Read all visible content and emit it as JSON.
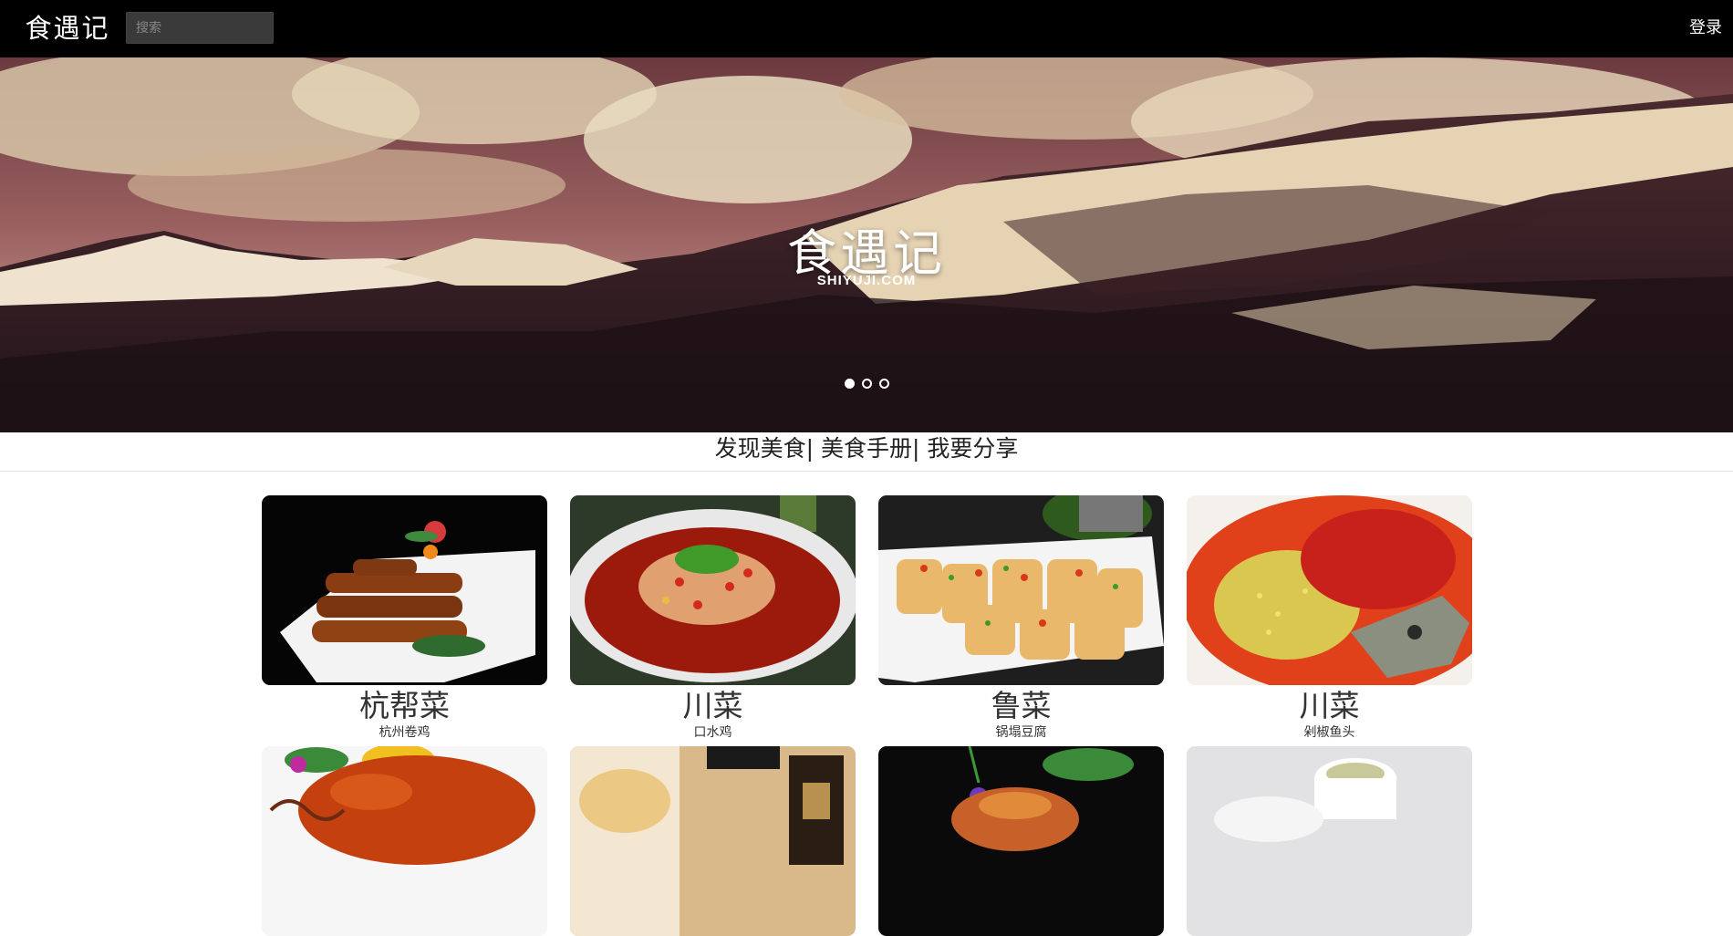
{
  "header": {
    "logo": "食遇记",
    "search_placeholder": "搜索",
    "login_label": "登录"
  },
  "banner": {
    "title": "食遇记",
    "subtitle": "SHIYUJI.COM",
    "slides": 3,
    "active_slide": 0
  },
  "nav": {
    "items": [
      "发现美食",
      "美食手册",
      "我要分享"
    ],
    "separator": "| "
  },
  "dishes": [
    {
      "category": "杭帮菜",
      "name": "杭州卷鸡",
      "icon": "braised-rolls-photo"
    },
    {
      "category": "川菜",
      "name": "口水鸡",
      "icon": "chili-chicken-photo"
    },
    {
      "category": "鲁菜",
      "name": "锅塌豆腐",
      "icon": "fried-tofu-photo"
    },
    {
      "category": "川菜",
      "name": "剁椒鱼头",
      "icon": "chili-fish-head-photo"
    },
    {
      "category": "",
      "name": "",
      "icon": "sweet-sour-ribs-photo"
    },
    {
      "category": "",
      "name": "",
      "icon": "drink-bottle-photo"
    },
    {
      "category": "",
      "name": "",
      "icon": "stir-fry-photo"
    },
    {
      "category": "",
      "name": "",
      "icon": "soup-cup-photo"
    }
  ],
  "colors": {
    "topbar": "#000000",
    "accent": "#ffffff"
  }
}
